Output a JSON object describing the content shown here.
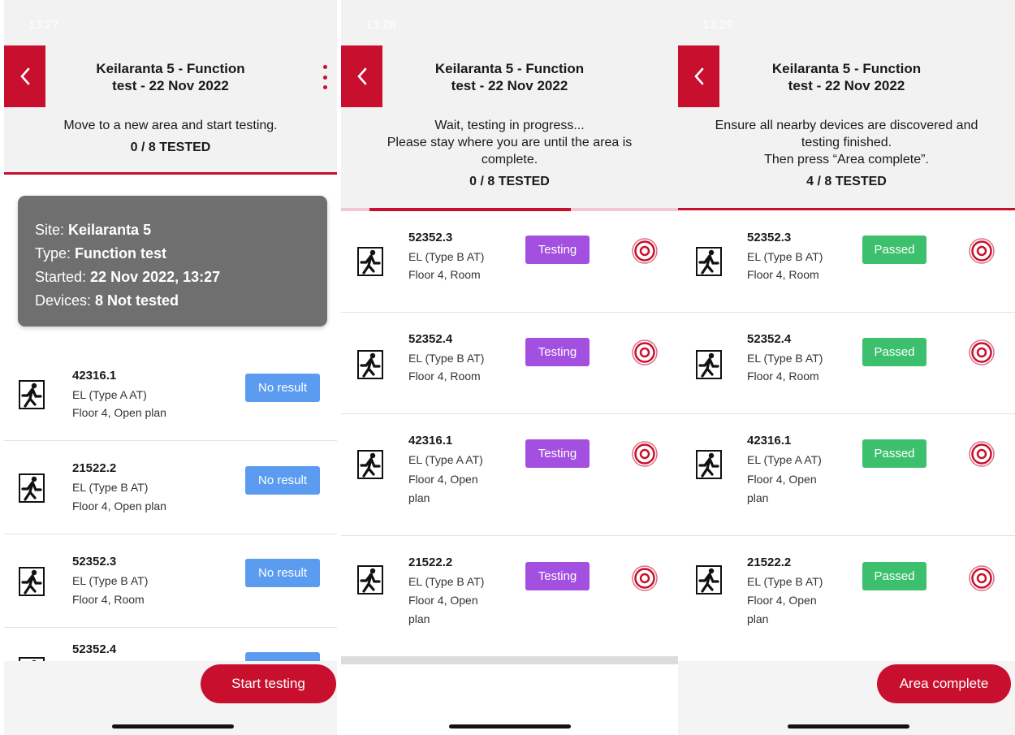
{
  "colors": {
    "brand_red": "#c8102e",
    "no_result_blue": "#5b9cf0",
    "testing_purple": "#a34fe0",
    "passed_green": "#3cc06e",
    "info_card_gray": "#6f6f6f"
  },
  "icons": {
    "back": "chevron-left-icon",
    "menu": "kebab-menu-icon",
    "device": "emergency-exit-icon",
    "locate": "target-icon"
  },
  "screens": [
    {
      "status_time": "13:27",
      "title_line1": "Keilaranta 5 - Function",
      "title_line2": "test - 22 Nov 2022",
      "instruction": "Move to a new area and start testing.",
      "tested": "0 / 8 TESTED",
      "info": {
        "site_label": "Site: ",
        "site_value": "Keilaranta 5",
        "type_label": "Type: ",
        "type_value": "Function test",
        "started_label": "Started: ",
        "started_value": "22 Nov 2022, 13:27",
        "devices_label": "Devices: ",
        "devices_value": "8 Not tested"
      },
      "devices": [
        {
          "id": "42316.1",
          "type": "EL (Type A AT)",
          "location": "Floor 4, Open plan",
          "status": "No result"
        },
        {
          "id": "21522.2",
          "type": "EL (Type B AT)",
          "location": "Floor 4, Open plan",
          "status": "No result"
        },
        {
          "id": "52352.3",
          "type": "EL (Type B AT)",
          "location": "Floor 4, Room",
          "status": "No result"
        },
        {
          "id": "52352.4",
          "type": "",
          "location": "",
          "status": ""
        }
      ],
      "button": "Start testing"
    },
    {
      "status_time": "13:28",
      "title_line1": "Keilaranta 5 - Function",
      "title_line2": "test - 22 Nov 2022",
      "instruction_lines": [
        "Wait, testing in progress...",
        "Please stay where you are until the area is",
        "complete."
      ],
      "tested": "0 / 8 TESTED",
      "devices": [
        {
          "id": "52352.3",
          "type": "EL (Type B AT)",
          "location_lines": [
            "Floor 4, Room"
          ],
          "status": "Testing"
        },
        {
          "id": "52352.4",
          "type": "EL (Type B AT)",
          "location_lines": [
            "Floor 4, Room"
          ],
          "status": "Testing"
        },
        {
          "id": "42316.1",
          "type": "EL (Type A AT)",
          "location_lines": [
            "Floor 4, Open",
            "plan"
          ],
          "status": "Testing"
        },
        {
          "id": "21522.2",
          "type": "EL (Type B AT)",
          "location_lines": [
            "Floor 4, Open",
            "plan"
          ],
          "status": "Testing"
        }
      ]
    },
    {
      "status_time": "13:29",
      "title_line1": "Keilaranta 5 - Function",
      "title_line2": "test - 22 Nov 2022",
      "instruction_lines": [
        "Ensure all nearby devices are discovered and",
        "testing finished.",
        "Then press “Area complete”."
      ],
      "tested": "4 / 8 TESTED",
      "devices": [
        {
          "id": "52352.3",
          "type": "EL (Type B AT)",
          "location_lines": [
            "Floor 4, Room"
          ],
          "status": "Passed"
        },
        {
          "id": "52352.4",
          "type": "EL (Type B AT)",
          "location_lines": [
            "Floor 4, Room"
          ],
          "status": "Passed"
        },
        {
          "id": "42316.1",
          "type": "EL (Type A AT)",
          "location_lines": [
            "Floor 4, Open",
            "plan"
          ],
          "status": "Passed"
        },
        {
          "id": "21522.2",
          "type": "EL (Type B AT)",
          "location_lines": [
            "Floor 4, Open",
            "plan"
          ],
          "status": "Passed"
        }
      ],
      "button": "Area complete"
    }
  ]
}
